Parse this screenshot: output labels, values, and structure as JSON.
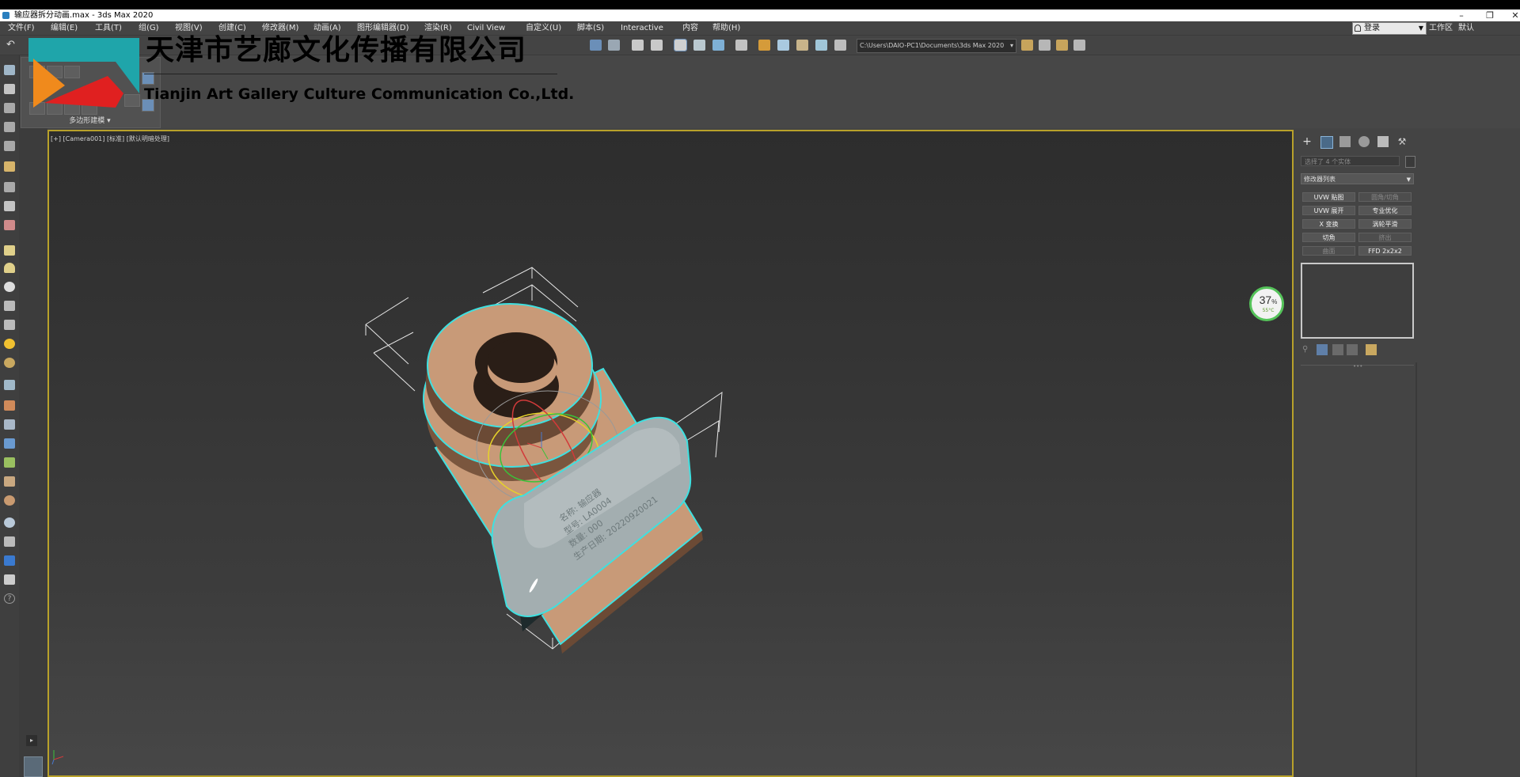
{
  "window": {
    "title": "输应器拆分动画.max - 3ds Max 2020",
    "controls": [
      "–",
      "❐",
      "✕"
    ]
  },
  "menu": [
    "文件(F)",
    "编辑(E)",
    "工具(T)",
    "组(G)",
    "视图(V)",
    "创建(C)",
    "修改器(M)",
    "动画(A)",
    "图形编辑器(D)",
    "渲染(R)",
    "Civil View",
    "自定义(U)",
    "脚本(S)",
    "Interactive",
    "内容",
    "帮助(H)"
  ],
  "account": {
    "login_label": "登录",
    "workspace_label": "工作区",
    "workspace_value": "默认"
  },
  "toolbar": {
    "project_path": "C:\\Users\\DAIO-PC1\\Documents\\3ds Max 2020"
  },
  "ribbon": {
    "panel_label": "多边形建模 ▾"
  },
  "viewport": {
    "label": "[+] [Camera001] [标准] [默认明暗处理]",
    "engraving": [
      "名称: 输应器",
      "型号: LA0004",
      "数量: 000",
      "生产日期: 20220920021"
    ]
  },
  "watermark": {
    "company_cn": "天津市艺廊文化传播有限公司",
    "company_en": "Tianjin Art Gallery Culture Communication Co.,Ltd."
  },
  "performance": {
    "percent": "37",
    "percent_unit": "%",
    "temperature": "55°C"
  },
  "command_panel": {
    "selection_text": "选择了 4 个实体",
    "modifier_list": "修改器列表",
    "modifier_buttons": [
      {
        "label": "UVW 贴图",
        "enabled": true
      },
      {
        "label": "圆角/切角",
        "enabled": false
      },
      {
        "label": "UVW 展开",
        "enabled": true
      },
      {
        "label": "专业优化",
        "enabled": true
      },
      {
        "label": "X 变换",
        "enabled": true
      },
      {
        "label": "涡轮平滑",
        "enabled": true
      },
      {
        "label": "切角",
        "enabled": true
      },
      {
        "label": "挤出",
        "enabled": false
      },
      {
        "label": "曲面",
        "enabled": false
      },
      {
        "label": "FFD 2x2x2",
        "enabled": true
      }
    ]
  },
  "colors": {
    "selection_cyan": "#3fe0e0",
    "model_peach": "#c89a78",
    "model_pad": "#a8b3b5",
    "viewport_border": "#b8a12a",
    "perf_ring": "#55c35a"
  }
}
